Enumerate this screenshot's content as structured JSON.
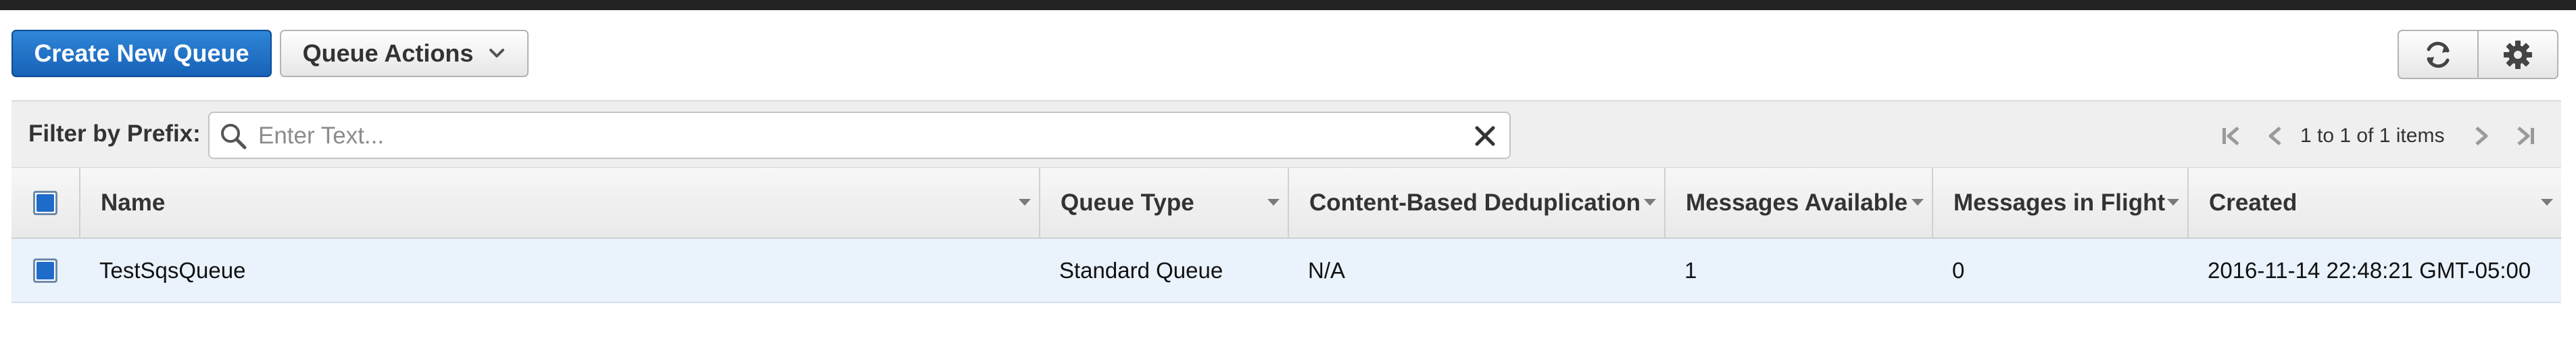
{
  "toolbar": {
    "create_label": "Create New Queue",
    "actions_label": "Queue Actions",
    "refresh_icon": "refresh-icon",
    "settings_icon": "gear-icon"
  },
  "filter": {
    "label": "Filter by Prefix:",
    "placeholder": "Enter Text...",
    "value": ""
  },
  "pagination": {
    "text": "1 to 1 of 1 items"
  },
  "table": {
    "columns": [
      "Name",
      "Queue Type",
      "Content-Based Deduplication",
      "Messages Available",
      "Messages in Flight",
      "Created"
    ],
    "rows": [
      {
        "selected": true,
        "name": "TestSqsQueue",
        "queue_type": "Standard Queue",
        "dedup": "N/A",
        "available": "1",
        "in_flight": "0",
        "created": "2016-11-14 22:48:21 GMT-05:00"
      }
    ]
  },
  "colors": {
    "primary": "#1f6bc9",
    "row_selected": "#eaf2fc"
  }
}
